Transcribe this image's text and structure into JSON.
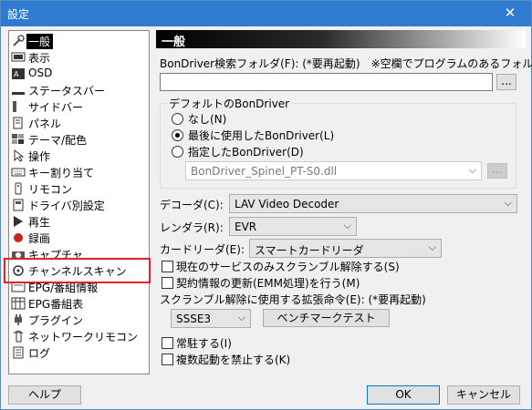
{
  "window": {
    "title": "設定",
    "close_glyph": "✕"
  },
  "sidebar": {
    "items": [
      {
        "label": "一般",
        "icon": "wrench-icon"
      },
      {
        "label": "表示",
        "icon": "display-icon"
      },
      {
        "label": "OSD",
        "icon": "osd-icon"
      },
      {
        "label": "ステータスバー",
        "icon": "statusbar-icon"
      },
      {
        "label": "サイドバー",
        "icon": "sidebar-icon"
      },
      {
        "label": "パネル",
        "icon": "panel-icon"
      },
      {
        "label": "テーマ/配色",
        "icon": "palette-icon"
      },
      {
        "label": "操作",
        "icon": "cursor-icon"
      },
      {
        "label": "キー割り当て",
        "icon": "keyboard-icon"
      },
      {
        "label": "リモコン",
        "icon": "remote-icon"
      },
      {
        "label": "ドライバ別設定",
        "icon": "driver-icon"
      },
      {
        "label": "再生",
        "icon": "play-icon"
      },
      {
        "label": "録画",
        "icon": "record-icon"
      },
      {
        "label": "キャプチャ",
        "icon": "camera-icon"
      },
      {
        "label": "チャンネルスキャン",
        "icon": "scan-icon"
      },
      {
        "label": "EPG/番組情報",
        "icon": "epg-info-icon"
      },
      {
        "label": "EPG番組表",
        "icon": "epg-table-icon"
      },
      {
        "label": "プラグイン",
        "icon": "plugin-icon"
      },
      {
        "label": "ネットワークリモコン",
        "icon": "network-remote-icon"
      },
      {
        "label": "ログ",
        "icon": "log-icon"
      }
    ]
  },
  "main": {
    "header": "一般",
    "bondriver_folder_label": "BonDriver検索フォルダ(F): (*要再起動)　※空欄でプログラムのあるフォルダ",
    "bondriver_folder_value": "",
    "browse_label": "...",
    "default_group": {
      "title": "デフォルトのBonDriver",
      "options": [
        "なし(N)",
        "最後に使用したBonDriver(L)",
        "指定したBonDriver(D)"
      ],
      "selected_index": 1,
      "specified_value": "BonDriver_Spinel_PT-S0.dll",
      "browse_label": "..."
    },
    "decoder_label": "デコーダ(C):",
    "decoder_value": "LAV Video Decoder",
    "renderer_label": "レンダラ(R):",
    "renderer_value": "EVR",
    "cardreader_label": "カードリーダ(E):",
    "cardreader_value": "スマートカードリーダ",
    "chk_descramble_current": "現在のサービスのみスクランブル解除する(S)",
    "chk_emm": "契約情報の更新(EMM処理)を行う(M)",
    "instruction_label": "スクランブル解除に使用する拡張命令(E): (*要再起動)",
    "instruction_value": "SSSE3",
    "benchmark_label": "ベンチマークテスト",
    "chk_resident": "常駐する(I)",
    "chk_no_multi": "複数起動を禁止する(K)"
  },
  "footer": {
    "help": "ヘルプ",
    "ok": "OK",
    "cancel": "キャンセル"
  }
}
